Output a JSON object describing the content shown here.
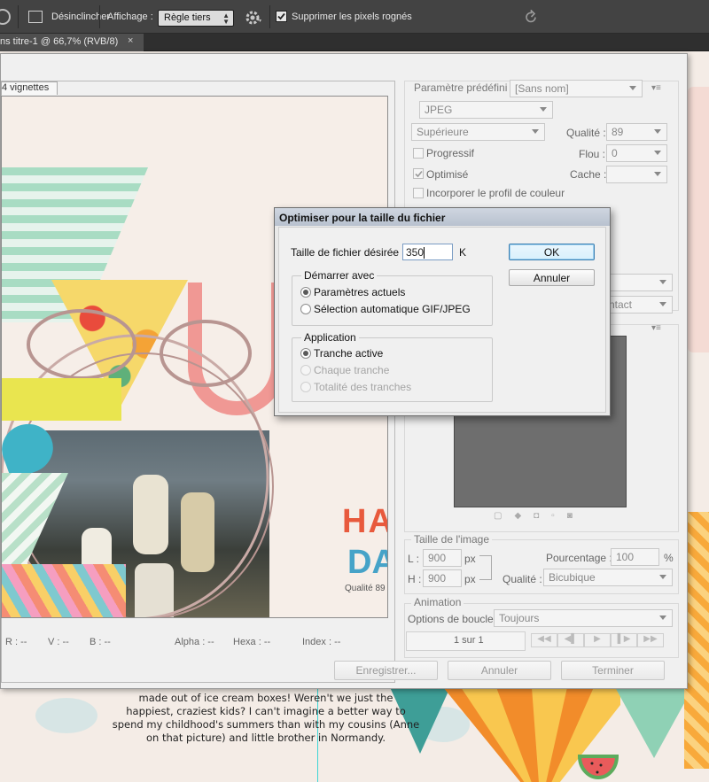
{
  "optionsbar": {
    "deskew_label": "Désinclincher",
    "display_label": "Affichage :",
    "display_value": "Règle tiers",
    "delete_cropped_label": "Supprimer les pixels rognés"
  },
  "doc_tab": {
    "title": "ns titre-1 @ 66,7% (RVB/8)",
    "close": "×"
  },
  "story": {
    "lines": [
      "made out of ice cream boxes! Weren't we just the",
      "happiest, craziest kids? I can't imagine a better way to",
      "spend my childhood's summers than with my cousins (Anne",
      "on that picture) and little brother in Normandy."
    ]
  },
  "sfw": {
    "tab_label": "4 vignettes",
    "preview_quality": "Qualité 89",
    "preview_text": [
      "HAP",
      "DA"
    ],
    "status": {
      "r": "R : --",
      "v": "V : --",
      "b": "B : --",
      "alpha": "Alpha : --",
      "hexa": "Hexa : --",
      "index": "Index : --"
    },
    "preset_label": "Paramètre prédéfini :",
    "preset_value": "[Sans nom]",
    "format": "JPEG",
    "quality_preset": "Supérieure",
    "quality_label": "Qualité :",
    "quality_value": "89",
    "progressive_label": "Progressif",
    "blur_label": "Flou :",
    "blur_value": "0",
    "optimized_label": "Optimisé",
    "matte_label": "Cache :",
    "icc_label": "Incorporer le profil de couleur",
    "contact_partial": "ntact",
    "image_size": {
      "title": "Taille de l'image",
      "w_label": "L :",
      "w_value": "900",
      "h_label": "H :",
      "h_value": "900",
      "unit": "px",
      "percent_label": "Pourcentage :",
      "percent_value": "100",
      "percent_unit": "%",
      "quality_label": "Qualité :",
      "quality_value": "Bicubique"
    },
    "animation": {
      "title": "Animation",
      "loop_label": "Options de boucle :",
      "loop_value": "Toujours",
      "frame_counter": "1 sur 1"
    },
    "buttons": {
      "save": "Enregistrer...",
      "cancel": "Annuler",
      "done": "Terminer"
    }
  },
  "modal": {
    "title": "Optimiser pour la taille du fichier",
    "size_label": "Taille de fichier désirée :",
    "size_value": "350",
    "size_unit": "K",
    "ok": "OK",
    "cancel": "Annuler",
    "start_group": "Démarrer avec",
    "start_options": [
      "Paramètres actuels",
      "Sélection automatique GIF/JPEG"
    ],
    "application_group": "Application",
    "application_options": [
      "Tranche active",
      "Chaque tranche",
      "Totalité des tranches"
    ]
  }
}
